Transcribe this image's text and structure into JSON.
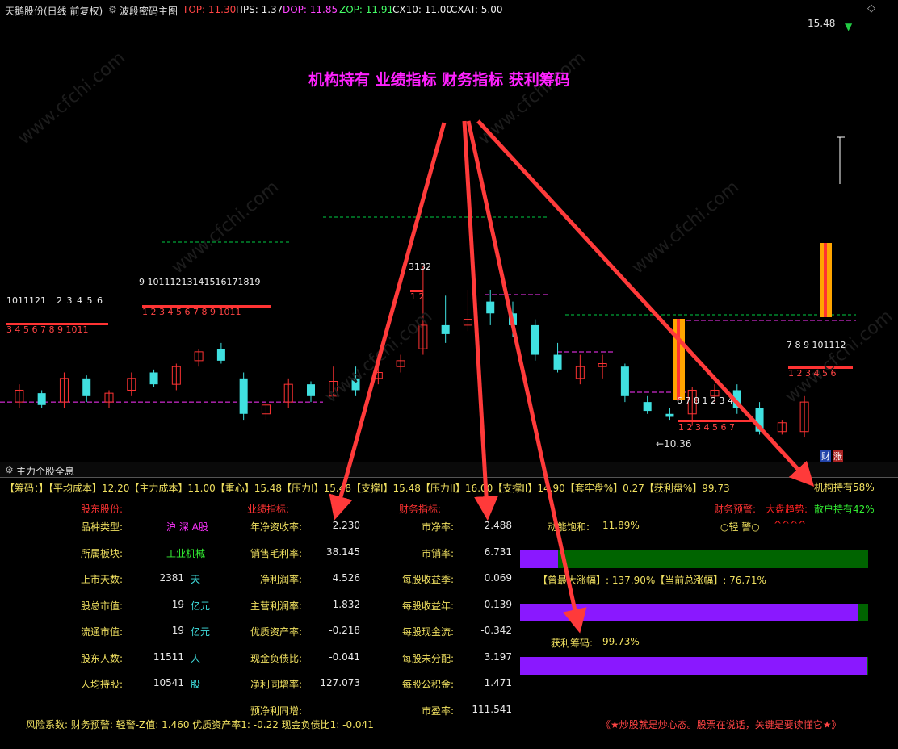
{
  "topbar": {
    "stock_name": "天鹅股份(日线 前复权)",
    "indicator_name": "波段密码主图",
    "top_label": "TOP: 11.30",
    "tips_label": "TIPS: 1.37",
    "dop_label": "DOP: 11.85",
    "zop_label": "ZOP: 11.91",
    "cx10_label": "CX10: 11.00",
    "cxat_label": "CXAT: 5.00",
    "high_label": "15.48",
    "low_label": "←10.36"
  },
  "colors": {
    "up": "#ff3333",
    "down": "#40e0e0",
    "magenta": "#ff33ff",
    "arrow": "#ff3a3a",
    "yellow": "#f0e060",
    "green": "#00cc44",
    "purple": "#8a18ff",
    "darkgreen": "#006400",
    "orange": "#ffa500"
  },
  "annotation": {
    "title": "机构持有 业绩指标 财务指标 获利筹码"
  },
  "sequence_labels": {
    "s1": "1011121",
    "s2": "2  3  4  5  6",
    "s3": "3  4  5  6  7  8  9  1011",
    "s4": "9  10111213141516171819",
    "s5": "1  2  3  4  5  6  7  8  9  1011",
    "s6": "3132",
    "s7": "1  2",
    "s8": "6  7  8  1  2  3  4",
    "s9": "1  2  3  4  5  6  7",
    "s10": "7  8  9    101112",
    "s11": "1  2  3  4  5  6"
  },
  "chart_data": {
    "type": "candlestick",
    "candles": [
      {
        "o": 11.0,
        "c": 11.2,
        "h": 11.3,
        "l": 10.9
      },
      {
        "o": 11.15,
        "c": 10.95,
        "h": 11.2,
        "l": 10.9
      },
      {
        "o": 11.0,
        "c": 11.4,
        "h": 11.5,
        "l": 10.9
      },
      {
        "o": 11.4,
        "c": 11.1,
        "h": 11.45,
        "l": 11.0
      },
      {
        "o": 11.0,
        "c": 11.15,
        "h": 11.2,
        "l": 10.9
      },
      {
        "o": 11.2,
        "c": 11.4,
        "h": 11.5,
        "l": 11.1
      },
      {
        "o": 11.5,
        "c": 11.3,
        "h": 11.55,
        "l": 11.25
      },
      {
        "o": 11.3,
        "c": 11.6,
        "h": 11.65,
        "l": 11.2
      },
      {
        "o": 11.7,
        "c": 11.85,
        "h": 11.9,
        "l": 11.6
      },
      {
        "o": 11.9,
        "c": 11.7,
        "h": 12.0,
        "l": 11.65
      },
      {
        "o": 11.4,
        "c": 10.8,
        "h": 11.5,
        "l": 10.7
      },
      {
        "o": 10.8,
        "c": 10.95,
        "h": 11.0,
        "l": 10.7
      },
      {
        "o": 11.0,
        "c": 11.3,
        "h": 11.4,
        "l": 10.9
      },
      {
        "o": 11.3,
        "c": 11.1,
        "h": 11.35,
        "l": 11.0
      },
      {
        "o": 11.1,
        "c": 11.35,
        "h": 11.6,
        "l": 11.1
      },
      {
        "o": 11.4,
        "c": 11.2,
        "h": 11.6,
        "l": 11.1
      },
      {
        "o": 11.4,
        "c": 11.5,
        "h": 11.7,
        "l": 11.3
      },
      {
        "o": 11.6,
        "c": 11.7,
        "h": 11.8,
        "l": 11.5
      },
      {
        "o": 11.9,
        "c": 12.3,
        "h": 13.3,
        "l": 11.8
      },
      {
        "o": 12.3,
        "c": 12.15,
        "h": 12.8,
        "l": 12.0
      },
      {
        "o": 12.3,
        "c": 12.4,
        "h": 12.9,
        "l": 12.2
      },
      {
        "o": 12.7,
        "c": 12.5,
        "h": 12.9,
        "l": 12.3
      },
      {
        "o": 12.5,
        "c": 12.3,
        "h": 12.7,
        "l": 12.1
      },
      {
        "o": 12.3,
        "c": 11.8,
        "h": 12.4,
        "l": 11.7
      },
      {
        "o": 11.8,
        "c": 11.55,
        "h": 12.0,
        "l": 11.5
      },
      {
        "o": 11.4,
        "c": 11.6,
        "h": 11.8,
        "l": 11.3
      },
      {
        "o": 11.6,
        "c": 11.65,
        "h": 11.8,
        "l": 11.4
      },
      {
        "o": 11.6,
        "c": 11.1,
        "h": 11.65,
        "l": 11.0
      },
      {
        "o": 11.0,
        "c": 10.85,
        "h": 11.1,
        "l": 10.8
      },
      {
        "o": 10.8,
        "c": 10.75,
        "h": 10.9,
        "l": 10.7
      },
      {
        "o": 10.8,
        "c": 11.2,
        "h": 11.25,
        "l": 10.6
      },
      {
        "o": 11.1,
        "c": 11.2,
        "h": 11.3,
        "l": 11.0
      },
      {
        "o": 11.2,
        "c": 10.9,
        "h": 11.3,
        "l": 10.8
      },
      {
        "o": 10.9,
        "c": 10.5,
        "h": 11.0,
        "l": 10.45
      },
      {
        "o": 10.5,
        "c": 10.65,
        "h": 10.7,
        "l": 10.45
      },
      {
        "o": 10.5,
        "c": 11.0,
        "h": 11.1,
        "l": 10.4
      }
    ],
    "levels": {
      "top": 11.3,
      "cx10": 11.0,
      "cxat": 5.0
    },
    "high_mark": 15.48,
    "low_mark": 10.36
  },
  "panel": {
    "title": "主力个股全息",
    "chip_line": "【筹码：】【平均成本】12.20【主力成本】11.00【重心】15.48【压力I】15.48【支撑I】15.48【压力II】16.00【支撑II】14.90【套牢盘%】0.27【获利盘%】99.73",
    "jigou_label": "机构持有58%",
    "sections": {
      "shareholders": "股东股份:",
      "performance": "业绩指标:",
      "finance": "财务指标:"
    },
    "warning_label": "财务预警:",
    "trend_label": "大盘趋势:",
    "retail_label": "散户持有42%",
    "light_warn": "○轻 警○",
    "carets": "^^^^",
    "kinetic_label": "动能饱和:",
    "kinetic_value": "11.89%",
    "rise_line": "【曾最大涨幅】: 137.90%【当前总涨幅】: 76.71%",
    "profit_label": "获利筹码:",
    "profit_value": "99.73%",
    "col1": [
      {
        "label": "品种类型:",
        "value": "沪 深 A股",
        "unit": ""
      },
      {
        "label": "所属板块:",
        "value": "工业机械",
        "unit": ""
      },
      {
        "label": "上市天数:",
        "value": "2381",
        "unit": "天"
      },
      {
        "label": "股总市值:",
        "value": "19",
        "unit": "亿元"
      },
      {
        "label": "流通市值:",
        "value": "19",
        "unit": "亿元"
      },
      {
        "label": "股东人数:",
        "value": "11511",
        "unit": "人"
      },
      {
        "label": "人均持股:",
        "value": "10541",
        "unit": "股"
      }
    ],
    "col2": [
      {
        "label": "年净资收率:",
        "value": "2.230"
      },
      {
        "label": "销售毛利率:",
        "value": "38.145"
      },
      {
        "label": "净利润率:",
        "value": "4.526"
      },
      {
        "label": "主营利润率:",
        "value": "1.832"
      },
      {
        "label": "优质资产率:",
        "value": "-0.218"
      },
      {
        "label": "现金负债比:",
        "value": "-0.041"
      },
      {
        "label": "净利同增率:",
        "value": "127.073"
      },
      {
        "label": "预净利同增:",
        "value": ""
      }
    ],
    "col3": [
      {
        "label": "市净率:",
        "value": "2.488"
      },
      {
        "label": "市销率:",
        "value": "6.731"
      },
      {
        "label": "每股收益季:",
        "value": "0.069"
      },
      {
        "label": "每股收益年:",
        "value": "0.139"
      },
      {
        "label": "每股现金流:",
        "value": "-0.342"
      },
      {
        "label": "每股未分配:",
        "value": "3.197"
      },
      {
        "label": "每股公积金:",
        "value": "1.471"
      },
      {
        "label": "市盈率:",
        "value": "111.541"
      }
    ],
    "risk_line": "风险系数: 财务预警: 轻警-Z值: 1.460 优质资产率1: -0.22 现金负债比1: -0.041",
    "slogan": "《★炒股就是炒心态。股票在说话，关键是要读懂它★》",
    "bars": {
      "kinetic_fill": 0.11,
      "rise_fill": 0.97,
      "profit_fill": 0.997
    },
    "badges": {
      "b1": "财",
      "b2": "涨"
    }
  }
}
